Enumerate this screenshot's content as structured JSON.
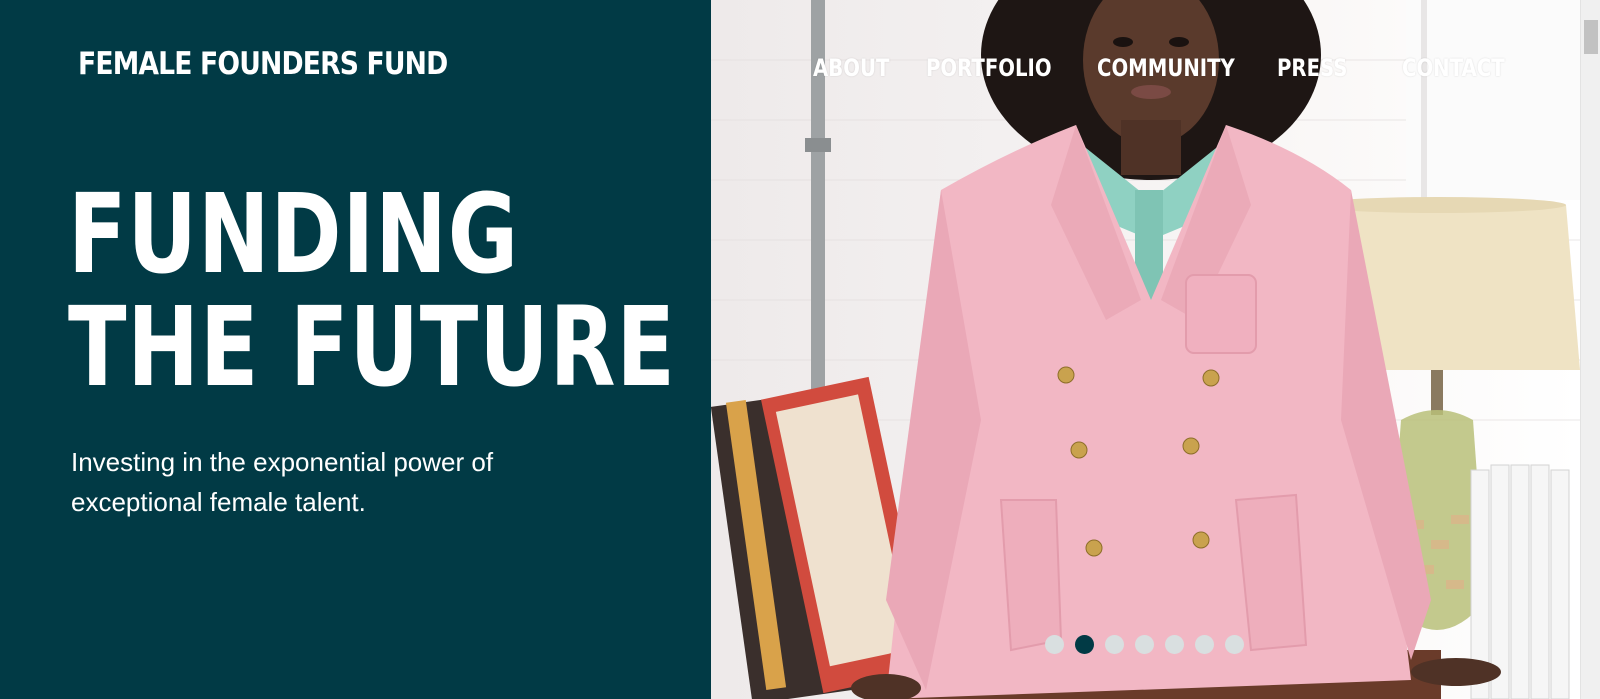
{
  "brand": {
    "logo_text": "FEMALE FOUNDERS FUND"
  },
  "nav": {
    "items": [
      {
        "label": "ABOUT"
      },
      {
        "label": "PORTFOLIO"
      },
      {
        "label": "COMMUNITY"
      },
      {
        "label": "PRESS"
      },
      {
        "label": "CONTACT"
      }
    ]
  },
  "hero": {
    "headline_line1": "FUNDING",
    "headline_line2": "THE FUTURE",
    "subtitle": "Investing in the exponential power of exceptional female talent."
  },
  "carousel": {
    "slide_count": 7,
    "active_index": 1
  },
  "colors": {
    "panel": "#013a45",
    "text": "#ffffff",
    "dot_inactive": "#d9dfe0",
    "dot_active": "#013a45",
    "blazer": "#f2b7c4"
  },
  "image": {
    "subject": "woman-in-pink-blazer"
  }
}
